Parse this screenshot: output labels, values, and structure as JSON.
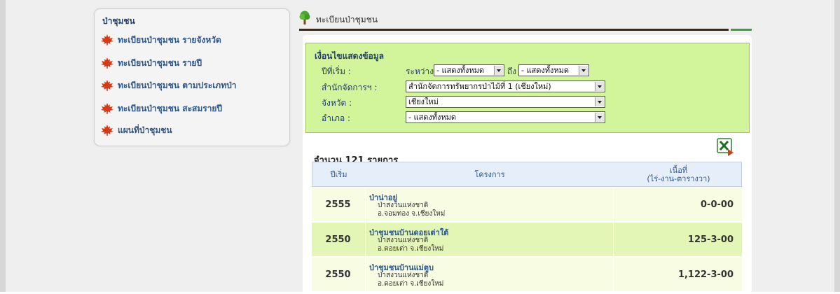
{
  "sidebar": {
    "title": "ป่าชุมชน",
    "items": [
      {
        "label": "ทะเบียนป่าชุมชน รายจังหวัด"
      },
      {
        "label": "ทะเบียนป่าชุมชน รายปี"
      },
      {
        "label": "ทะเบียนป่าชุมชน ตามประเภทป่า"
      },
      {
        "label": "ทะเบียนป่าชุมชน สะสมรายปี"
      },
      {
        "label": "แผนที่ป่าชุมชน"
      }
    ]
  },
  "breadcrumb": {
    "title": "ทะเบียนป่าชุมชน"
  },
  "filter": {
    "title": "เงื่อนไขแสดงข้อมูล",
    "start_year_label": "ปีที่เริ่ม :",
    "between_label": "ระหว่าง",
    "to_label": "ถึง",
    "year_from_value": "- แสดงทั้งหมด",
    "year_to_value": "- แสดงทั้งหมด",
    "office_label": "สำนักจัดการฯ :",
    "office_value": "สำนักจัดการทรัพยากรป่าไม้ที่ 1 (เชียงใหม่)",
    "province_label": "จังหวัด :",
    "province_value": "เชียงใหม่",
    "district_label": "อำเภอ :",
    "district_value": "- แสดงทั้งหมด"
  },
  "results": {
    "count_label": "จำนวน 121 รายการ"
  },
  "table": {
    "headers": {
      "year": "ปีเริ่ม",
      "project": "โครงการ",
      "area_line1": "เนื้อที่",
      "area_line2": "(ไร่-งาน-ตารางวา)"
    },
    "rows": [
      {
        "year": "2555",
        "name": "ป่าน่าอยู่",
        "type": "ป่าสงวนแห่งชาติ",
        "location": "อ.จอมทอง จ.เชียงใหม่",
        "area": "0-0-00"
      },
      {
        "year": "2550",
        "name": "ป่าชุมชนบ้านดอยเต่าใต้",
        "type": "ป่าสงวนแห่งชาติ",
        "location": "อ.ดอยเต่า จ.เชียงใหม่",
        "area": "125-3-00"
      },
      {
        "year": "2550",
        "name": "ป่าชุมชนบ้านแม่ตูบ",
        "type": "ป่าสงวนแห่งชาติ",
        "location": "อ.ดอยเต่า จ.เชียงใหม่",
        "area": "1,122-3-00"
      }
    ]
  },
  "colors": {
    "page_bg": "#efefef",
    "link_blue": "#2b5790",
    "filter_bg": "#d2f49a",
    "row_odd": "#f7fce3",
    "row_even": "#e4f6b6",
    "header_bg": "#e6eef9",
    "leaf_red": "#d83a16"
  }
}
